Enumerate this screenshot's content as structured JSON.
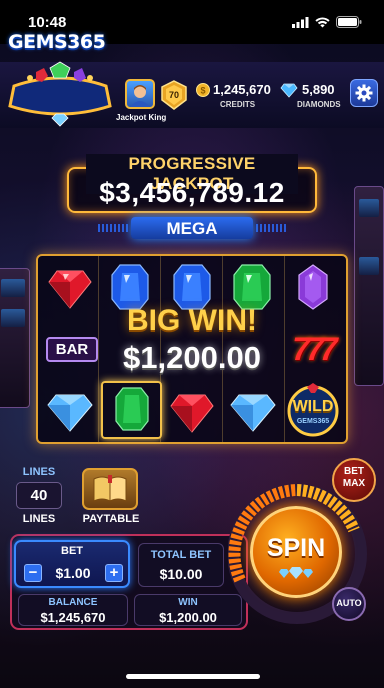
{
  "status_bar": {
    "time": "10:48"
  },
  "header": {
    "logo": "GEMS365",
    "username": "Jackpot King",
    "level": "70",
    "credits": {
      "value": "1,245,670",
      "label": "CREDITS"
    },
    "diamonds": {
      "value": "5,890",
      "label": "DIAMONDS"
    },
    "settings_icon": "gear-icon"
  },
  "jackpot": {
    "title": "PROGRESSIVE JACKPOT",
    "amount": "$3,456,789.12",
    "tier": "MEGA"
  },
  "reels": {
    "symbols": [
      [
        "ruby",
        "bar",
        "diamond"
      ],
      [
        "sapphire",
        "amethyst-shard",
        "emerald"
      ],
      [
        "sapphire",
        "win-overlay",
        "ruby"
      ],
      [
        "emerald",
        "win-overlay",
        "diamond"
      ],
      [
        "amethyst",
        "seven",
        "wild"
      ]
    ],
    "bar_label": "BAR",
    "seven_label": "777",
    "wild_label": "WILD",
    "wild_sub": "GEMS365"
  },
  "big_win": {
    "title": "BIG WIN!",
    "amount": "$1,200.00"
  },
  "controls": {
    "lines_label": "LINES",
    "lines_value": "40",
    "lines_sub": "LINES",
    "paytable_label": "PAYTABLE",
    "bet_label": "BET",
    "bet_value": "$1.00",
    "bet_minus": "−",
    "bet_plus": "+",
    "total_bet_label": "TOTAL BET",
    "total_bet_value": "$10.00",
    "balance_label": "BALANCE",
    "balance_value": "$1,245,670",
    "win_label": "WIN",
    "win_value": "$1,200.00",
    "spin_label": "SPIN",
    "bet_max_label_1": "BET",
    "bet_max_label_2": "MAX",
    "auto_label": "AUTO"
  },
  "colors": {
    "gold": "#ffd36a",
    "ruby": "#e0182a",
    "sapphire": "#1d5ae8",
    "emerald": "#15a83a",
    "amethyst": "#8a3ad8",
    "diamond": "#5ab8ff"
  }
}
